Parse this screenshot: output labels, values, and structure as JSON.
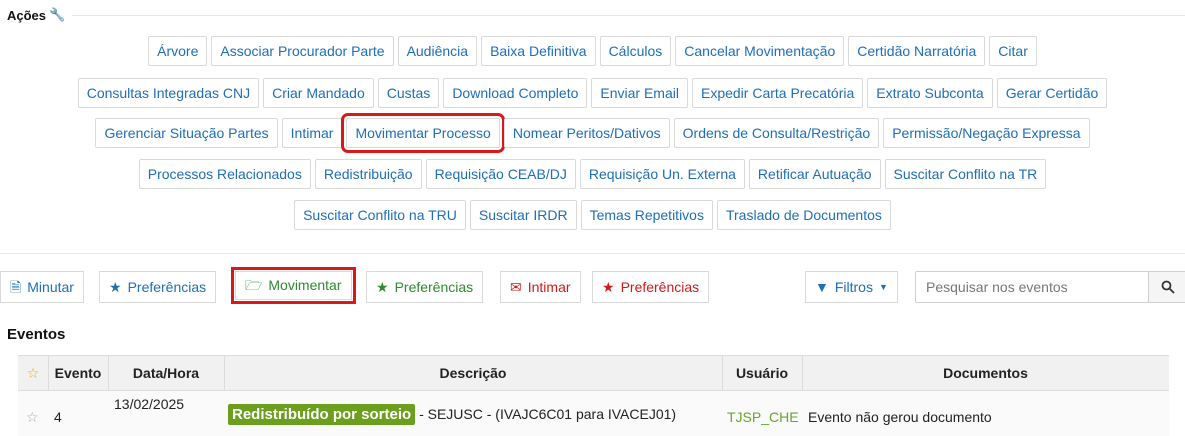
{
  "acoes": {
    "title": "Ações",
    "rows": [
      [
        "Árvore",
        "Associar Procurador Parte",
        "Audiência",
        "Baixa Definitiva",
        "Cálculos",
        "Cancelar Movimentação",
        "Certidão Narratória",
        "Citar"
      ],
      [
        "Consultas Integradas CNJ",
        "Criar Mandado",
        "Custas",
        "Download Completo",
        "Enviar Email",
        "Expedir Carta Precatória",
        "Extrato Subconta",
        "Gerar Certidão"
      ],
      [
        "Gerenciar Situação Partes",
        "Intimar",
        "Movimentar Processo",
        "Nomear Peritos/Dativos",
        "Ordens de Consulta/Restrição",
        "Permissão/Negação Expressa"
      ],
      [
        "Processos Relacionados",
        "Redistribuição",
        "Requisição CEAB/DJ",
        "Requisição Un. Externa",
        "Retificar Autuação",
        "Suscitar Conflito na TR"
      ],
      [
        "Suscitar Conflito na TRU",
        "Suscitar IRDR",
        "Temas Repetitivos",
        "Traslado de Documentos"
      ]
    ],
    "highlighted": "Movimentar Processo"
  },
  "toolbar": {
    "minutar": "Minutar",
    "preferencias_1": "Preferências",
    "movimentar": "Movimentar",
    "preferencias_2": "Preferências",
    "intimar": "Intimar",
    "preferencias_3": "Preferências",
    "filtros": "Filtros",
    "search_placeholder": "Pesquisar nos eventos",
    "highlighted": "Movimentar"
  },
  "eventos": {
    "title": "Eventos",
    "columns": [
      "Evento",
      "Data/Hora",
      "Descrição",
      "Usuário",
      "Documentos"
    ],
    "rows": [
      {
        "evento": "4",
        "data_hora": "13/02/2025",
        "descricao_badge": "Redistribuído por sorteio",
        "descricao_text": "- SEJUSC - (IVAJC6C01 para IVACEJ01)",
        "usuario": "TJSP_CHE",
        "documentos": "Evento não gerou documento"
      }
    ]
  },
  "colors": {
    "link_blue": "#1e6eb8",
    "green": "#2e8b2e",
    "red": "#d31a1a",
    "highlight_red": "#d9181a",
    "badge_green": "#6c9f1e"
  }
}
